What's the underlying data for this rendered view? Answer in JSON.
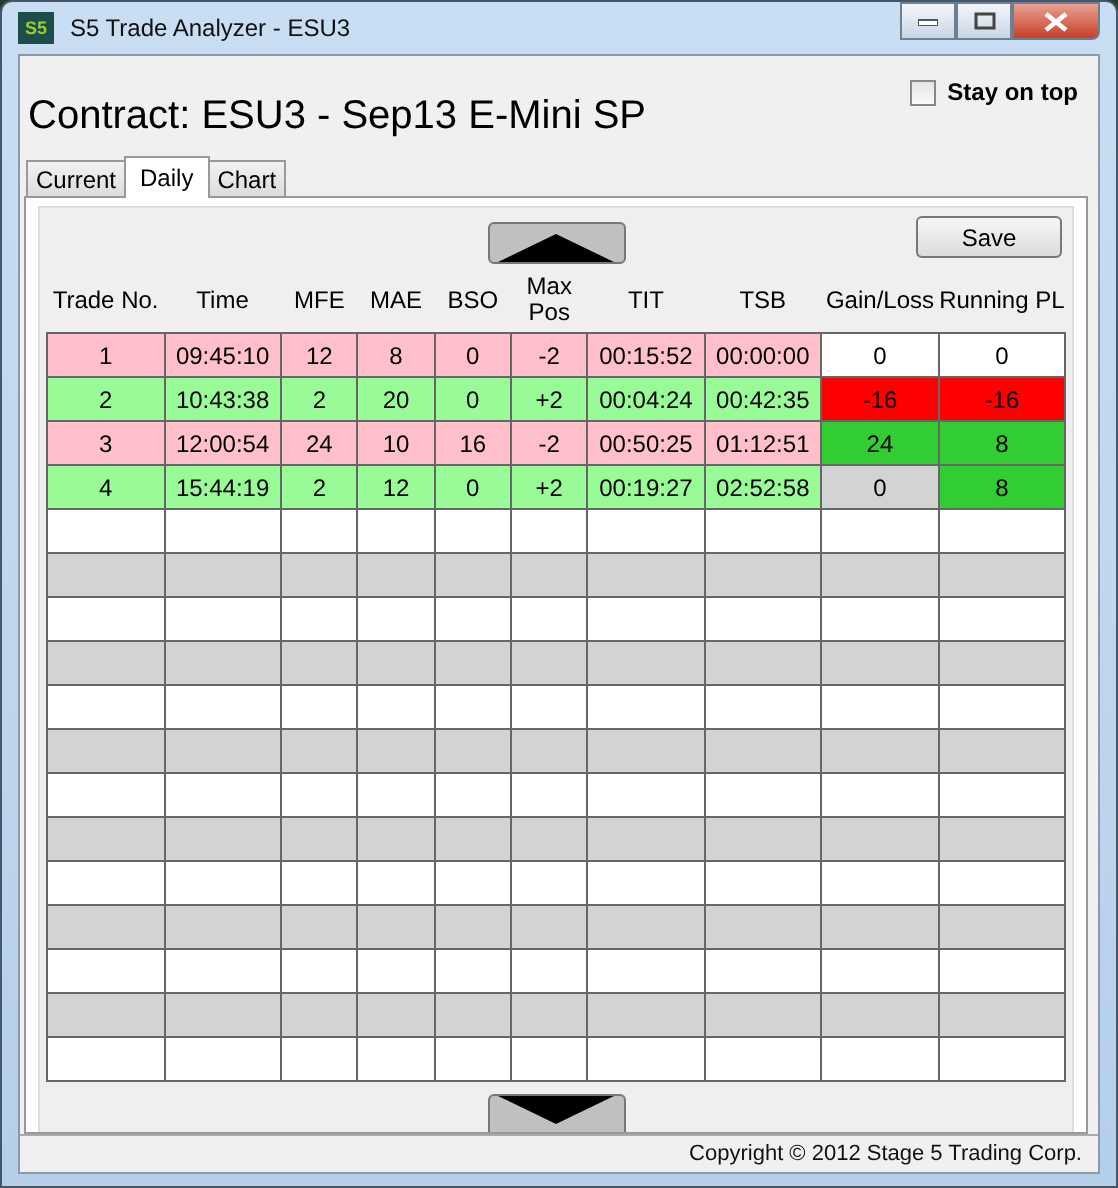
{
  "window": {
    "title": "S5 Trade Analyzer - ESU3",
    "logo": "S5"
  },
  "heading": "Contract: ESU3 - Sep13 E-Mini SP",
  "stay_on_top": {
    "label": "Stay on top",
    "checked": false
  },
  "tabs": [
    {
      "label": "Current",
      "selected": false
    },
    {
      "label": "Daily",
      "selected": true
    },
    {
      "label": "Chart",
      "selected": false
    }
  ],
  "save_button": "Save",
  "table": {
    "columns": [
      "Trade No.",
      "Time",
      "MFE",
      "MAE",
      "BSO",
      "Max Pos",
      "TIT",
      "TSB",
      "Gain/Loss",
      "Running PL"
    ],
    "rows": [
      {
        "color": "#ffc0cb",
        "cells": [
          "1",
          "09:45:10",
          "12",
          "8",
          "0",
          "-2",
          "00:15:52",
          "00:00:00"
        ],
        "gain_loss": {
          "text": "0",
          "color": "#ffffff"
        },
        "running_pl": {
          "text": "0",
          "color": "#ffffff"
        }
      },
      {
        "color": "#98fb98",
        "cells": [
          "2",
          "10:43:38",
          "2",
          "20",
          "0",
          "+2",
          "00:04:24",
          "00:42:35"
        ],
        "gain_loss": {
          "text": "-16",
          "color": "#ff0000"
        },
        "running_pl": {
          "text": "-16",
          "color": "#ff0000"
        }
      },
      {
        "color": "#ffc0cb",
        "cells": [
          "3",
          "12:00:54",
          "24",
          "10",
          "16",
          "-2",
          "00:50:25",
          "01:12:51"
        ],
        "gain_loss": {
          "text": "24",
          "color": "#32cd32"
        },
        "running_pl": {
          "text": "8",
          "color": "#32cd32"
        }
      },
      {
        "color": "#98fb98",
        "cells": [
          "4",
          "15:44:19",
          "2",
          "12",
          "0",
          "+2",
          "00:19:27",
          "02:52:58"
        ],
        "gain_loss": {
          "text": "0",
          "color": "#d3d3d3"
        },
        "running_pl": {
          "text": "8",
          "color": "#32cd32"
        }
      }
    ]
  },
  "status_bar": "Copyright © 2012 Stage 5 Trading Corp."
}
